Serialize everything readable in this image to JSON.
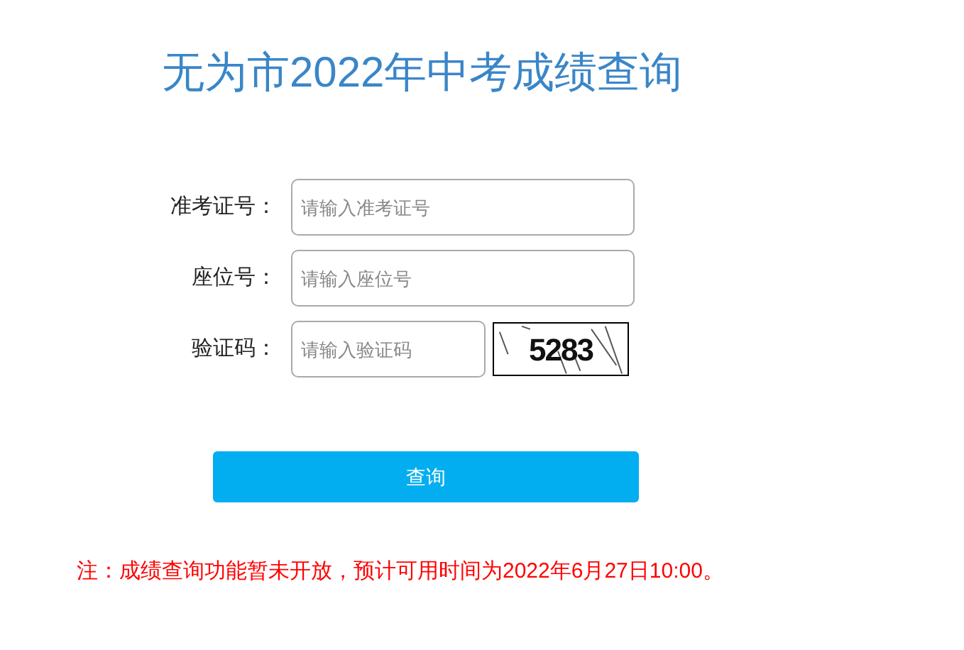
{
  "title": "无为市2022年中考成绩查询",
  "fields": [
    {
      "label": "准考证号：",
      "placeholder": "请输入准考证号",
      "kind": "text"
    },
    {
      "label": "座位号：",
      "placeholder": "请输入座位号",
      "kind": "text"
    },
    {
      "label": "验证码：",
      "placeholder": "请输入验证码",
      "kind": "captcha",
      "captcha": "5283"
    }
  ],
  "button": "查询",
  "notice": "注：成绩查询功能暂未开放，预计可用时间为2022年6月27日10:00。"
}
